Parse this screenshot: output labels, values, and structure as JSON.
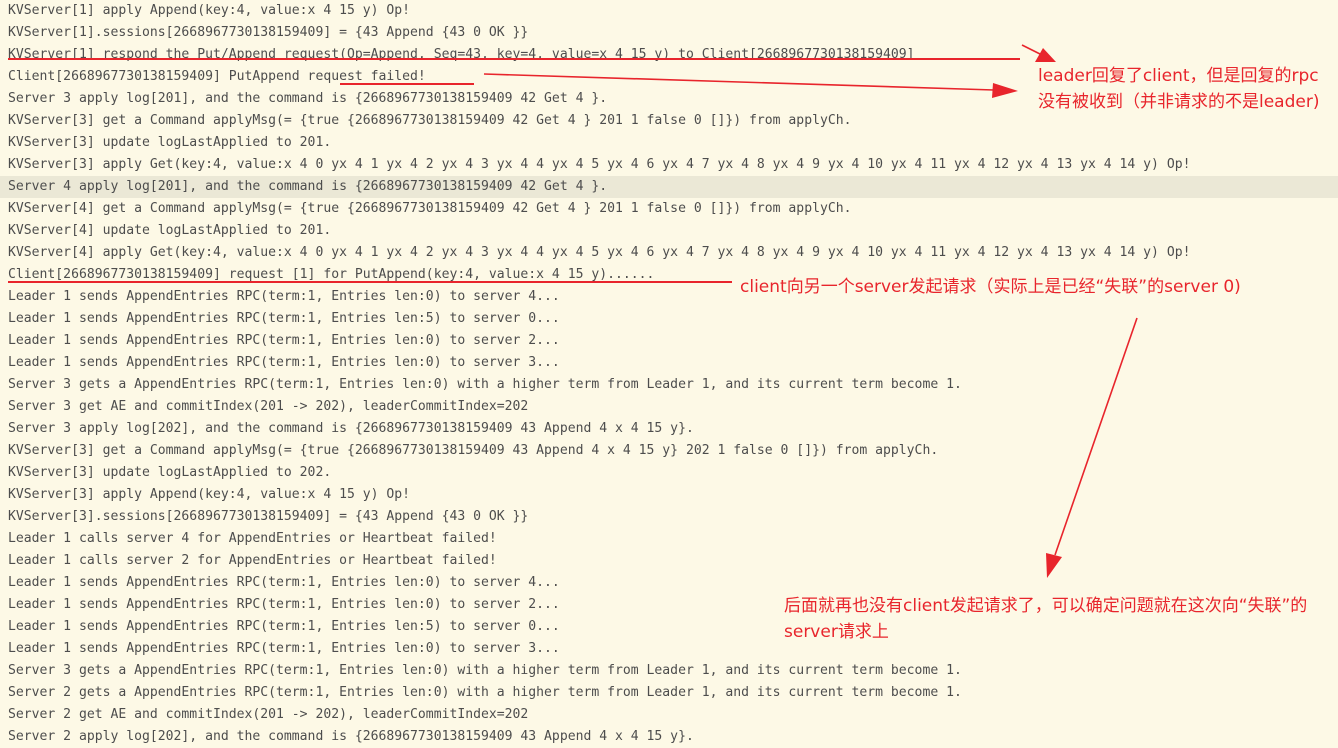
{
  "log_lines": [
    "KVServer[1] apply Append(key:4, value:x 4 15 y) Op!",
    "KVServer[1].sessions[2668967730138159409] = {43 Append {43 0 OK }}",
    "KVServer[1] respond the Put/Append request(Op=Append, Seq=43, key=4, value=x 4 15 y) to Client[2668967730138159409]",
    "Client[2668967730138159409] PutAppend request failed!",
    "Server 3 apply log[201], and the command is {2668967730138159409 42 Get 4 }.",
    "KVServer[3] get a Command applyMsg(= {true {2668967730138159409 42 Get 4 } 201 1 false 0 []}) from applyCh.",
    "KVServer[3] update logLastApplied to 201.",
    "KVServer[3] apply Get(key:4, value:x 4 0 yx 4 1 yx 4 2 yx 4 3 yx 4 4 yx 4 5 yx 4 6 yx 4 7 yx 4 8 yx 4 9 yx 4 10 yx 4 11 yx 4 12 yx 4 13 yx 4 14 y) Op!",
    "Server 4 apply log[201], and the command is {2668967730138159409 42 Get 4 }.",
    "KVServer[4] get a Command applyMsg(= {true {2668967730138159409 42 Get 4 } 201 1 false 0 []}) from applyCh.",
    "KVServer[4] update logLastApplied to 201.",
    "KVServer[4] apply Get(key:4, value:x 4 0 yx 4 1 yx 4 2 yx 4 3 yx 4 4 yx 4 5 yx 4 6 yx 4 7 yx 4 8 yx 4 9 yx 4 10 yx 4 11 yx 4 12 yx 4 13 yx 4 14 y) Op!",
    "Client[2668967730138159409] request [1] for PutAppend(key:4, value:x 4 15 y)......",
    "Leader 1 sends AppendEntries RPC(term:1, Entries len:0) to server 4...",
    "Leader 1 sends AppendEntries RPC(term:1, Entries len:5) to server 0...",
    "Leader 1 sends AppendEntries RPC(term:1, Entries len:0) to server 2...",
    "Leader 1 sends AppendEntries RPC(term:1, Entries len:0) to server 3...",
    "Server 3 gets a AppendEntries RPC(term:1, Entries len:0) with a higher term from Leader 1, and its current term become 1.",
    "Server 3 get AE and commitIndex(201 -> 202), leaderCommitIndex=202",
    "Server 3 apply log[202], and the command is {2668967730138159409 43 Append 4 x 4 15 y}.",
    "KVServer[3] get a Command applyMsg(= {true {2668967730138159409 43 Append 4 x 4 15 y} 202 1 false 0 []}) from applyCh.",
    "KVServer[3] update logLastApplied to 202.",
    "KVServer[3] apply Append(key:4, value:x 4 15 y) Op!",
    "KVServer[3].sessions[2668967730138159409] = {43 Append {43 0 OK }}",
    "Leader 1 calls server 4 for AppendEntries or Heartbeat failed!",
    "Leader 1 calls server 2 for AppendEntries or Heartbeat failed!",
    "Leader 1 sends AppendEntries RPC(term:1, Entries len:0) to server 4...",
    "Leader 1 sends AppendEntries RPC(term:1, Entries len:0) to server 2...",
    "Leader 1 sends AppendEntries RPC(term:1, Entries len:5) to server 0...",
    "Leader 1 sends AppendEntries RPC(term:1, Entries len:0) to server 3...",
    "Server 3 gets a AppendEntries RPC(term:1, Entries len:0) with a higher term from Leader 1, and its current term become 1.",
    "Server 2 gets a AppendEntries RPC(term:1, Entries len:0) with a higher term from Leader 1, and its current term become 1.",
    "Server 2 get AE and commitIndex(201 -> 202), leaderCommitIndex=202",
    "Server 2 apply log[202], and the command is {2668967730138159409 43 Append 4 x 4 15 y}."
  ],
  "highlighted_line_index": 8,
  "annotations": {
    "reply_not_received": "leader回复了client，但是回复的rpc没有被收到（并非请求的不是leader)",
    "retry_to_lost_server": "client向另一个server发起请求（实际上是已经“失联”的server 0)",
    "no_more_requests": "后面就再也没有client发起请求了，可以确定问题就在这次向“失联”的server请求上"
  },
  "colors": {
    "background": "#fdf9e6",
    "highlight_row": "#ebe8d6",
    "log_text": "#4d4d4d",
    "annotation": "#e8252c"
  }
}
